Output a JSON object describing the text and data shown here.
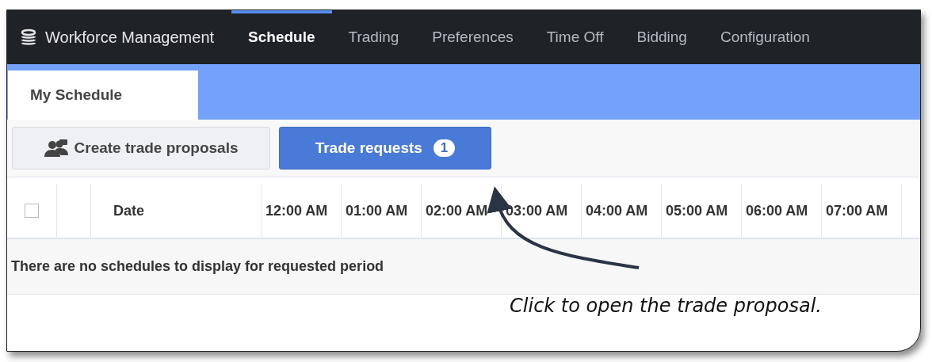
{
  "app": {
    "title": "Workforce Management"
  },
  "nav_tabs": [
    {
      "label": "Schedule",
      "selected": true
    },
    {
      "label": "Trading",
      "selected": false
    },
    {
      "label": "Preferences",
      "selected": false
    },
    {
      "label": "Time Off",
      "selected": false
    },
    {
      "label": "Bidding",
      "selected": false
    },
    {
      "label": "Configuration",
      "selected": false
    }
  ],
  "page_tabs": [
    {
      "label": "My Schedule",
      "selected": true
    }
  ],
  "toolbar": {
    "buttons": [
      {
        "kind": "secondary",
        "label": "Create trade proposals"
      },
      {
        "kind": "primary",
        "label": "Trade requests",
        "badge": "1"
      }
    ]
  },
  "table": {
    "select_all": {
      "checked": false
    },
    "date_column": "Date",
    "hour_columns": [
      "12:00 AM",
      "01:00 AM",
      "02:00 AM",
      "03:00 AM",
      "04:00 AM",
      "05:00 AM",
      "06:00 AM",
      "07:00 AM"
    ],
    "empty_message": "There are no schedules to display for requested period"
  },
  "annotation": {
    "text": "Click to open the trade proposal."
  }
}
